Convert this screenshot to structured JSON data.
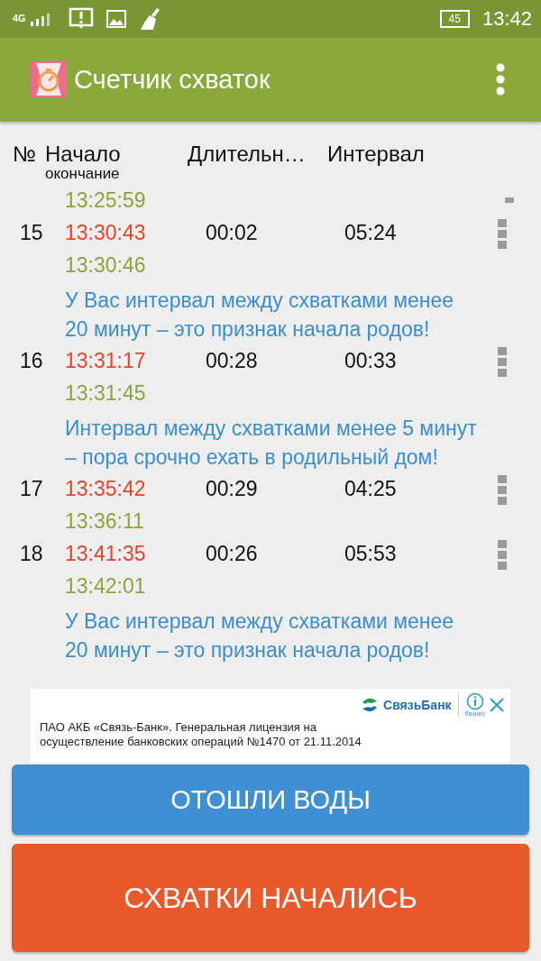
{
  "status_bar": {
    "network": "4G",
    "battery": "45",
    "time": "13:42"
  },
  "app_bar": {
    "title": "Счетчик схваток"
  },
  "table": {
    "columns": [
      "№",
      "Начало",
      "окончание",
      "Длительн…",
      "Интервал"
    ],
    "rows": [
      {
        "end": "13:25:59"
      },
      {
        "number": "15",
        "start": "13:30:43",
        "end": "13:30:46",
        "duration": "00:02",
        "interval": "05:24",
        "message": "У Вас интервал между схватками менее 20 минут – это признак начала родов!"
      },
      {
        "number": "16",
        "start": "13:31:17",
        "end": "13:31:45",
        "duration": "00:28",
        "interval": "00:33",
        "message": "Интервал между схватками менее 5 минут – пора срочно ехать в родильный дом!"
      },
      {
        "number": "17",
        "start": "13:35:42",
        "end": "13:36:11",
        "duration": "00:29",
        "interval": "04:25"
      },
      {
        "number": "18",
        "start": "13:41:35",
        "end": "13:42:01",
        "duration": "00:26",
        "interval": "05:53",
        "message": "У Вас интервал между схватками менее 20 минут – это признак начала родов!"
      }
    ]
  },
  "ad": {
    "brand": "СвязьБанк",
    "brand_sub": "бизнес",
    "text": "ПАО АКБ «Связь-Банк». Генеральная лицензия на осуществление банковских операций №1470 от 21.11.2014"
  },
  "buttons": [
    {
      "label": "ОТОШЛИ ВОДЫ",
      "kind": "water"
    },
    {
      "label": "СХВАТКИ НАЧАЛИСЬ",
      "kind": "start"
    }
  ]
}
